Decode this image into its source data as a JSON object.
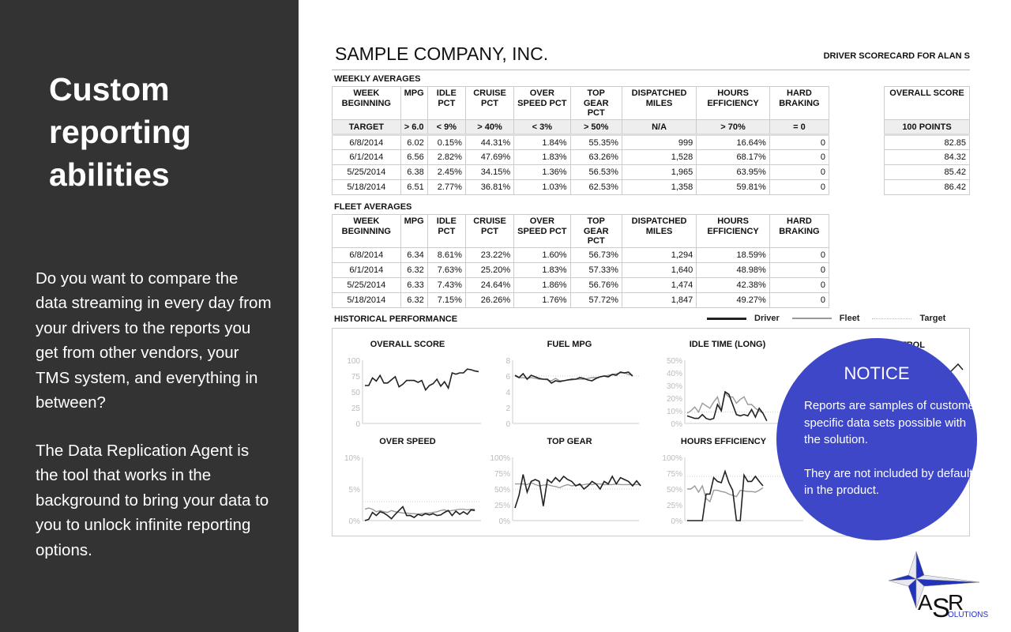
{
  "slide": {
    "heading": "Custom reporting abilities",
    "paragraphs": [
      "Do you want to compare the data streaming in every day from your drivers to the reports you get from other vendors, your TMS system, and everything in between?",
      "The Data Replication Agent is the tool that works in the background to bring your data to you to unlock infinite reporting options."
    ]
  },
  "report": {
    "company": "SAMPLE COMPANY, INC.",
    "scorecard_label": "DRIVER SCORECARD FOR ALAN S",
    "weekly": {
      "title": "WEEKLY AVERAGES",
      "headers": [
        "WEEK BEGINNING",
        "MPG",
        "IDLE PCT",
        "CRUISE PCT",
        "OVER SPEED PCT",
        "TOP GEAR PCT",
        "DISPATCHED MILES",
        "HOURS EFFICIENCY",
        "HARD BRAKING"
      ],
      "target": [
        "TARGET",
        "> 6.0",
        "< 9%",
        "> 40%",
        "< 3%",
        "> 50%",
        "N/A",
        "> 70%",
        "= 0"
      ],
      "rows": [
        [
          "6/8/2014",
          "6.02",
          "0.15%",
          "44.31%",
          "1.84%",
          "55.35%",
          "999",
          "16.64%",
          "0"
        ],
        [
          "6/1/2014",
          "6.56",
          "2.82%",
          "47.69%",
          "1.83%",
          "63.26%",
          "1,528",
          "68.17%",
          "0"
        ],
        [
          "5/25/2014",
          "6.38",
          "2.45%",
          "34.15%",
          "1.36%",
          "56.53%",
          "1,965",
          "63.95%",
          "0"
        ],
        [
          "5/18/2014",
          "6.51",
          "2.77%",
          "36.81%",
          "1.03%",
          "62.53%",
          "1,358",
          "59.81%",
          "0"
        ]
      ],
      "overall": {
        "header": "OVERALL SCORE",
        "target": "100 POINTS",
        "values": [
          "82.85",
          "84.32",
          "85.42",
          "86.42"
        ]
      }
    },
    "fleet": {
      "title": "FLEET AVERAGES",
      "headers": [
        "WEEK BEGINNING",
        "MPG",
        "IDLE PCT",
        "CRUISE PCT",
        "OVER SPEED PCT",
        "TOP GEAR PCT",
        "DISPATCHED MILES",
        "HOURS EFFICIENCY",
        "HARD BRAKING"
      ],
      "rows": [
        [
          "6/8/2014",
          "6.34",
          "8.61%",
          "23.22%",
          "1.60%",
          "56.73%",
          "1,294",
          "18.59%",
          "0"
        ],
        [
          "6/1/2014",
          "6.32",
          "7.63%",
          "25.20%",
          "1.83%",
          "57.33%",
          "1,640",
          "48.98%",
          "0"
        ],
        [
          "5/25/2014",
          "6.33",
          "7.43%",
          "24.64%",
          "1.86%",
          "56.76%",
          "1,474",
          "42.38%",
          "0"
        ],
        [
          "5/18/2014",
          "6.32",
          "7.15%",
          "26.26%",
          "1.76%",
          "57.72%",
          "1,847",
          "49.27%",
          "0"
        ]
      ]
    },
    "historical": {
      "title": "HISTORICAL PERFORMANCE",
      "legend": [
        "Driver",
        "Fleet",
        "Target"
      ],
      "colors": {
        "driver": "#222222",
        "fleet": "#999999",
        "target": "#cccccc"
      }
    }
  },
  "chart_data": [
    {
      "type": "line",
      "title": "OVERALL SCORE",
      "ylim": [
        0,
        100
      ],
      "ticks": [
        "0",
        "25",
        "50",
        "75",
        "100"
      ],
      "series": [
        {
          "name": "Driver",
          "values": [
            60,
            60,
            72,
            67,
            76,
            64,
            64,
            69,
            74,
            58,
            62,
            68,
            68,
            68,
            65,
            68,
            53,
            60,
            63,
            70,
            59,
            66,
            56,
            80,
            78,
            80,
            80,
            86,
            85,
            83,
            82
          ]
        }
      ]
    },
    {
      "type": "line",
      "title": "FUEL MPG",
      "ylim": [
        0,
        8
      ],
      "ticks": [
        "0",
        "2",
        "4",
        "6",
        "8"
      ],
      "target": 6,
      "series": [
        {
          "name": "Driver",
          "values": [
            6.1,
            5.8,
            6.3,
            5.6,
            6.1,
            5.9,
            5.7,
            5.6,
            5.6,
            5.1,
            5.4,
            5.3,
            5.4,
            5.5,
            5.6,
            5.6,
            5.8,
            5.7,
            5.5,
            5.4,
            5.7,
            5.9,
            6.0,
            5.9,
            6.2,
            6.1,
            6.5,
            6.4,
            6.5,
            6.0
          ]
        },
        {
          "name": "Fleet",
          "values": [
            6.0,
            5.8,
            5.8,
            5.7,
            5.8,
            5.7,
            5.6,
            5.6,
            5.5,
            5.4,
            5.7,
            5.4,
            5.4,
            5.5,
            5.5,
            5.6,
            5.6,
            5.6,
            5.7,
            5.8,
            5.8,
            5.9,
            6.0,
            6.1,
            6.2,
            6.3,
            6.4,
            6.4,
            6.2,
            6.1
          ]
        }
      ]
    },
    {
      "type": "line",
      "title": "IDLE TIME (LONG)",
      "ylim": [
        0,
        50
      ],
      "ticks": [
        "0%",
        "10%",
        "20%",
        "30%",
        "40%",
        "50%"
      ],
      "target": 9,
      "series": [
        {
          "name": "Driver",
          "values": [
            6,
            5,
            4,
            4,
            7,
            4,
            3,
            4,
            15,
            10,
            25,
            23,
            15,
            7,
            6,
            7,
            6,
            11,
            5,
            12,
            8,
            2
          ]
        },
        {
          "name": "Fleet",
          "values": [
            8,
            10,
            13,
            9,
            16,
            14,
            12,
            17,
            21,
            10,
            24,
            21,
            21,
            16,
            19,
            21,
            15,
            15,
            12,
            10,
            8
          ]
        }
      ]
    },
    {
      "type": "line",
      "title": "OVER SPEED",
      "ylim": [
        0,
        10
      ],
      "ticks": [
        "0%",
        "5%",
        "10%"
      ],
      "target": 3,
      "series": [
        {
          "name": "Driver",
          "values": [
            0,
            0.2,
            1.3,
            0.8,
            1.4,
            1.2,
            0.8,
            0.3,
            1.0,
            1.6,
            2.2,
            0.8,
            0.8,
            0.5,
            1.0,
            0.8,
            1.1,
            0.9,
            1.1,
            0.8,
            0.9,
            1.3,
            1.6,
            0.8,
            1.5,
            1.0,
            1.4,
            1.0,
            1.7,
            1.6
          ]
        },
        {
          "name": "Fleet",
          "values": [
            1.8,
            2.0,
            1.8,
            1.4,
            1.6,
            1.4,
            1.3,
            1.6,
            1.4,
            1.3,
            1.2,
            1.2,
            1.1,
            1.1,
            1.0,
            1.1,
            1.2,
            1.2,
            1.3,
            1.4,
            1.6,
            1.7,
            1.5,
            1.6,
            1.7,
            1.8,
            1.8,
            1.7,
            1.8,
            1.8
          ]
        }
      ]
    },
    {
      "type": "line",
      "title": "TOP GEAR",
      "ylim": [
        0,
        100
      ],
      "ticks": [
        "0%",
        "25%",
        "50%",
        "75%",
        "100%"
      ],
      "target": 50,
      "series": [
        {
          "name": "Driver",
          "values": [
            20,
            40,
            73,
            45,
            62,
            65,
            62,
            23,
            65,
            60,
            68,
            62,
            70,
            65,
            62,
            55,
            58,
            50,
            55,
            62,
            58,
            50,
            62,
            58,
            70,
            58,
            68,
            65,
            62,
            55,
            63,
            55
          ]
        },
        {
          "name": "Fleet",
          "values": [
            58,
            58,
            58,
            57,
            60,
            57,
            55,
            56,
            57,
            55,
            54,
            52,
            55,
            57,
            55,
            56,
            56,
            57,
            58,
            57,
            58,
            58,
            57,
            57,
            57,
            58,
            57,
            57,
            57,
            57,
            57,
            57
          ]
        }
      ]
    },
    {
      "type": "line",
      "title": "HOURS EFFICIENCY",
      "ylim": [
        0,
        100
      ],
      "ticks": [
        "0%",
        "25%",
        "50%",
        "75%",
        "100%"
      ],
      "target": 70,
      "series": [
        {
          "name": "Driver",
          "values": [
            0,
            0,
            0,
            0,
            0,
            42,
            42,
            68,
            62,
            60,
            78,
            60,
            48,
            0,
            0,
            72,
            62,
            62,
            70,
            62,
            55
          ]
        },
        {
          "name": "Fleet",
          "values": [
            50,
            50,
            55,
            45,
            55,
            35,
            30,
            48,
            48,
            46,
            45,
            42,
            40,
            38,
            48,
            47,
            46,
            46,
            45,
            48,
            52
          ]
        }
      ]
    }
  ],
  "hidden_chart_title": "TROL",
  "notice": {
    "title": "NOTICE",
    "body": [
      "Reports are samples of customer specific data sets possible with the solution.",
      "They are not included by default in the product."
    ],
    "color": "#3d47c8"
  },
  "logo": {
    "text": "ASR SOLUTIONS",
    "colors": [
      "#2233bb",
      "#e8e8f0"
    ]
  }
}
